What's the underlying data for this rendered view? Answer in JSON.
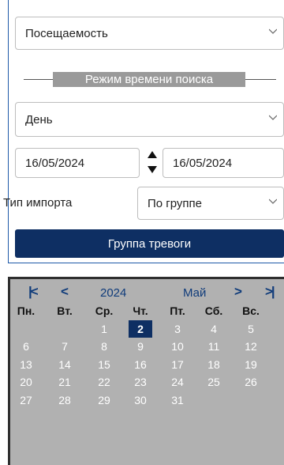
{
  "form": {
    "report_select": "Посещаемость",
    "mode_label": "Режим времени поиска",
    "period_select": "День",
    "date_from": "16/05/2024",
    "date_to": "16/05/2024",
    "import_type_label": "Тип импорта",
    "import_type_value": "По группе",
    "alarm_group_button": "Группа тревоги"
  },
  "calendar": {
    "year": "2024",
    "month": "Май",
    "nav": {
      "first": "|<",
      "prev": "<",
      "next": ">",
      "last": ">|"
    },
    "weekdays": [
      "Пн.",
      "Вт.",
      "Ср.",
      "Чт.",
      "Пт.",
      "Сб.",
      "Вс."
    ],
    "weeks": [
      [
        "",
        "",
        "1",
        "2",
        "3",
        "4",
        "5"
      ],
      [
        "6",
        "7",
        "8",
        "9",
        "10",
        "11",
        "12"
      ],
      [
        "13",
        "14",
        "15",
        "16",
        "17",
        "18",
        "19"
      ],
      [
        "20",
        "21",
        "22",
        "23",
        "24",
        "25",
        "26"
      ],
      [
        "27",
        "28",
        "29",
        "30",
        "31",
        "",
        ""
      ]
    ],
    "selected_day": "2",
    "colors": {
      "selected": "#0e2f63",
      "background": "#b1b1b1",
      "nav": "#0f3b7a"
    }
  }
}
